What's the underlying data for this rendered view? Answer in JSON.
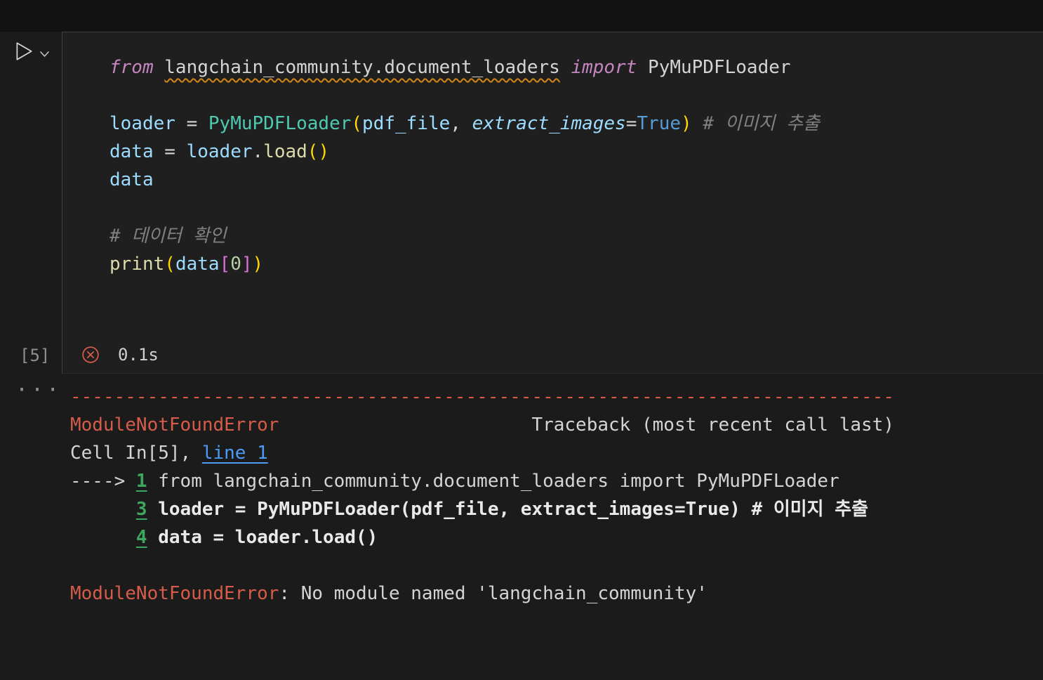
{
  "colors": {
    "bg": "#1b1b1b",
    "editor_bg": "#1f1f1f",
    "border": "#3f3f46",
    "top_gap": "#121212",
    "pl": "#d4d4d4",
    "kw": "#c586c0",
    "var": "#9cdcfe",
    "cls": "#4ec9b0",
    "fn": "#dcdcaa",
    "bool": "#569cd6",
    "num": "#b5cea8",
    "cmt": "#808080",
    "b1": "#ffd700",
    "b2": "#da70d6",
    "warn": "#d18616",
    "err": "#d65c4a",
    "link": "#4c9bf5",
    "ln": "#3da65f",
    "bold": "#e9e9e9",
    "muted": "#8f8f8f"
  },
  "icons": {
    "run": "play-outline-triangle",
    "chevron": "chevron-down",
    "error": "circled-x",
    "more": "···"
  },
  "cell": {
    "execution_count": "[5]",
    "duration": "0.1s",
    "code_lines": [
      [
        {
          "t": "from",
          "c": "kw"
        },
        {
          "t": " ",
          "c": "pl"
        },
        {
          "t": "langchain_community.document_loaders",
          "c": "warn"
        },
        {
          "t": " ",
          "c": "pl"
        },
        {
          "t": "import",
          "c": "kw"
        },
        {
          "t": " PyMuPDFLoader",
          "c": "pl"
        }
      ],
      [],
      [
        {
          "t": "loader",
          "c": "var"
        },
        {
          "t": " = ",
          "c": "pl"
        },
        {
          "t": "PyMuPDFLoader",
          "c": "cls"
        },
        {
          "t": "(",
          "c": "b1"
        },
        {
          "t": "pdf_file",
          "c": "var"
        },
        {
          "t": ", ",
          "c": "pl"
        },
        {
          "t": "extract_images",
          "c": "param"
        },
        {
          "t": "=",
          "c": "pl"
        },
        {
          "t": "True",
          "c": "bool"
        },
        {
          "t": ")",
          "c": "b1"
        },
        {
          "t": " ",
          "c": "pl"
        },
        {
          "t": "# 이미지 추출",
          "c": "cmt"
        }
      ],
      [
        {
          "t": "data",
          "c": "var"
        },
        {
          "t": " = ",
          "c": "pl"
        },
        {
          "t": "loader",
          "c": "var"
        },
        {
          "t": ".",
          "c": "pl"
        },
        {
          "t": "load",
          "c": "fn"
        },
        {
          "t": "(",
          "c": "b1"
        },
        {
          "t": ")",
          "c": "b1"
        }
      ],
      [
        {
          "t": "data",
          "c": "var"
        }
      ],
      [],
      [
        {
          "t": "# 데이터 확인",
          "c": "cmt"
        }
      ],
      [
        {
          "t": "print",
          "c": "fn"
        },
        {
          "t": "(",
          "c": "b1"
        },
        {
          "t": "data",
          "c": "var"
        },
        {
          "t": "[",
          "c": "b2"
        },
        {
          "t": "0",
          "c": "num"
        },
        {
          "t": "]",
          "c": "b2"
        },
        {
          "t": ")",
          "c": "b1"
        }
      ]
    ]
  },
  "output": {
    "lines": [
      [
        {
          "t": "---------------------------------------------------------------------------",
          "c": "err"
        }
      ],
      [
        {
          "t": "ModuleNotFoundError",
          "c": "err"
        },
        {
          "t": "                       Traceback (most recent call last)",
          "c": "pl"
        }
      ],
      [
        {
          "t": "Cell In[5], ",
          "c": "pl"
        },
        {
          "t": "line 1",
          "c": "link"
        }
      ],
      [
        {
          "t": "----> ",
          "c": "pl"
        },
        {
          "t": "1",
          "c": "ln"
        },
        {
          "t": " from langchain_community.document_loaders import PyMuPDFLoader",
          "c": "pl"
        }
      ],
      [
        {
          "t": "      ",
          "c": "pl"
        },
        {
          "t": "3",
          "c": "ln"
        },
        {
          "t": " ",
          "c": "pl"
        },
        {
          "t": "loader = PyMuPDFLoader(pdf_file, extract_images=True) # 이미지 추출",
          "c": "bold"
        }
      ],
      [
        {
          "t": "      ",
          "c": "pl"
        },
        {
          "t": "4",
          "c": "ln"
        },
        {
          "t": " ",
          "c": "pl"
        },
        {
          "t": "data = loader.load()",
          "c": "bold"
        }
      ],
      [],
      [
        {
          "t": "ModuleNotFoundError",
          "c": "err"
        },
        {
          "t": ": No module named 'langchain_community'",
          "c": "pl"
        }
      ]
    ]
  }
}
